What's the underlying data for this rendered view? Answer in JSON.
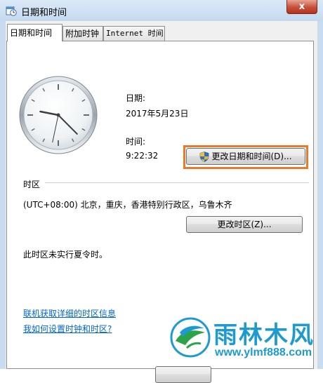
{
  "window": {
    "title": "日期和时间",
    "close_label": "x"
  },
  "tabs": [
    {
      "label": "日期和时间",
      "active": true
    },
    {
      "label": "附加时钟",
      "active": false
    },
    {
      "label": "Internet 时间",
      "active": false
    }
  ],
  "datetime": {
    "date_label": "日期:",
    "date_value": "2017年5月23日",
    "time_label": "时间:",
    "time_value": "9:22:32",
    "change_button": "更改日期和时间(D)..."
  },
  "timezone": {
    "section_label": "时区",
    "value": "(UTC+08:00) 北京，重庆，香港特别行政区，乌鲁木齐",
    "change_button": "更改时区(Z)...",
    "dst_note": "此时区未实行夏令时。"
  },
  "links": {
    "online_info": "联机获取详细的时区信息",
    "how_to": "我如何设置时钟和时区?"
  },
  "clock": {
    "hour": 9,
    "minute": 22,
    "second": 32
  },
  "watermark": {
    "title": "雨林木风",
    "url": "www.ylmf888.com"
  },
  "colors": {
    "highlight": "#e87a2a",
    "link": "#0066cc",
    "watermark": "#1d9bd1"
  }
}
